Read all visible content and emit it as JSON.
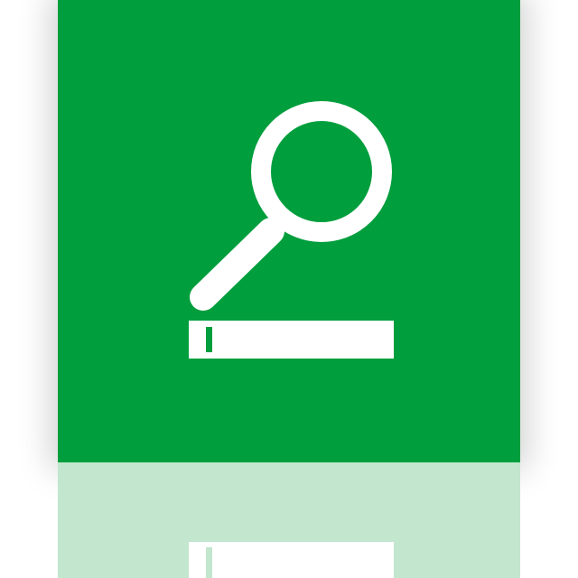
{
  "tile": {
    "background_color": "#009E3D",
    "glyph_color": "#FFFFFF",
    "reflection_color": "#C2E6CE",
    "icon": "search-field-icon",
    "parts": [
      "magnifier-icon",
      "text-field-icon",
      "text-cursor-icon"
    ]
  }
}
